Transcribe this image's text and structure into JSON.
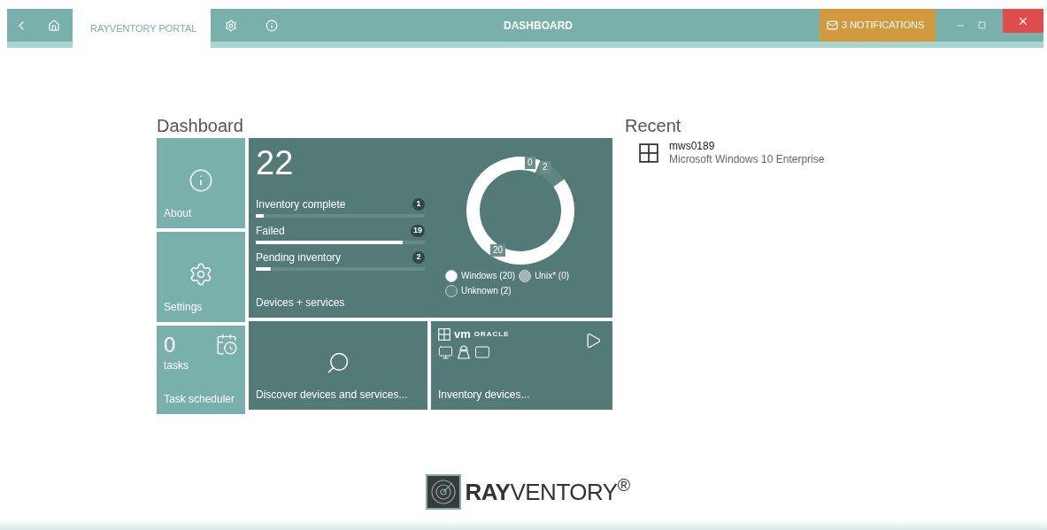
{
  "title_bar": {
    "tabs": [
      {
        "label": "RAYVENTORY PORTAL",
        "selected": true
      }
    ],
    "title": "DASHBOARD",
    "notifications": "3 NOTIFICATIONS"
  },
  "dashboard": {
    "heading": "Dashboard",
    "tiles": [
      {
        "kind": "about",
        "label": "About"
      },
      {
        "kind": "settings",
        "label": "Settings"
      },
      {
        "kind": "tasks",
        "count": "0",
        "unit": "tasks",
        "label": "Task scheduler"
      }
    ],
    "devices": {
      "total": "22",
      "label": "Devices + services",
      "statuses": [
        {
          "name": "Inventory complete",
          "count": "1",
          "level": 0.045
        },
        {
          "name": "Failed",
          "count": "19",
          "level": 0.87
        },
        {
          "name": "Pending inventory",
          "count": "2",
          "level": 0.09
        }
      ],
      "chart_data": {
        "type": "donut",
        "categories": [
          "Windows (20)",
          "Unix* (0)",
          "Unknown (2)"
        ],
        "series": [
          {
            "values": [
              20,
              0,
              2
            ]
          }
        ],
        "value_labels": [
          "20",
          "0",
          "2"
        ]
      },
      "legend": [
        {
          "color": "#ffffff"
        },
        {
          "color": "#a3b5b2"
        },
        {
          "color": "#5f8582"
        }
      ]
    },
    "discover": {
      "label": "Discover devices and services..."
    },
    "inventory": {
      "vm": "vm",
      "oracle": "ORACLE",
      "label": "Inventory devices..."
    }
  },
  "recent": {
    "heading": "Recent",
    "items": [
      {
        "name": "mws0189",
        "detail": "Microsoft Windows 10 Enterprise"
      }
    ]
  },
  "logo": "**RAY**VENTORY$^{®}$"
}
